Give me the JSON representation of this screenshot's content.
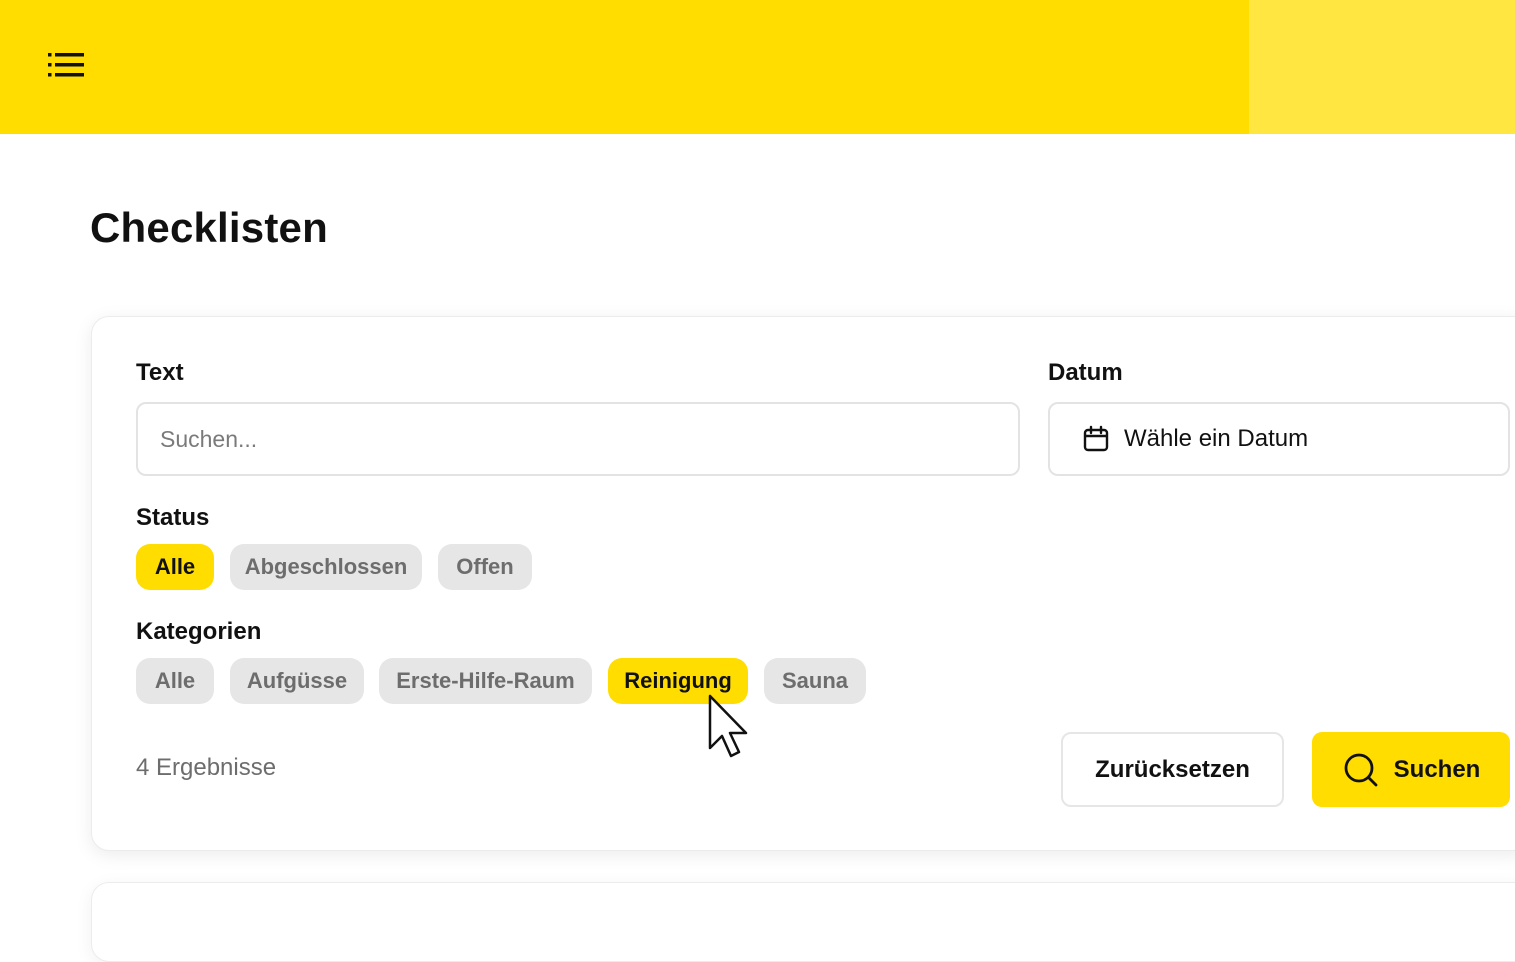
{
  "header": {
    "menu_icon": "hamburger-menu-icon",
    "colors": {
      "primary": "#FFDD00",
      "secondary": "#FFE640"
    }
  },
  "page": {
    "title": "Checklisten"
  },
  "filters": {
    "text": {
      "label": "Text",
      "placeholder": "Suchen...",
      "value": ""
    },
    "date": {
      "label": "Datum",
      "icon": "calendar-icon",
      "placeholder": "Wähle ein Datum"
    },
    "status": {
      "label": "Status",
      "options": [
        {
          "label": "Alle",
          "active": true
        },
        {
          "label": "Abgeschlossen",
          "active": false
        },
        {
          "label": "Offen",
          "active": false
        }
      ]
    },
    "categories": {
      "label": "Kategorien",
      "options": [
        {
          "label": "Alle",
          "active": false
        },
        {
          "label": "Aufgüsse",
          "active": false
        },
        {
          "label": "Erste-Hilfe-Raum",
          "active": false
        },
        {
          "label": "Reinigung",
          "active": true
        },
        {
          "label": "Sauna",
          "active": false
        }
      ]
    }
  },
  "footer": {
    "results": "4 Ergebnisse",
    "reset_label": "Zurücksetzen",
    "search_label": "Suchen",
    "search_icon": "search-icon"
  }
}
